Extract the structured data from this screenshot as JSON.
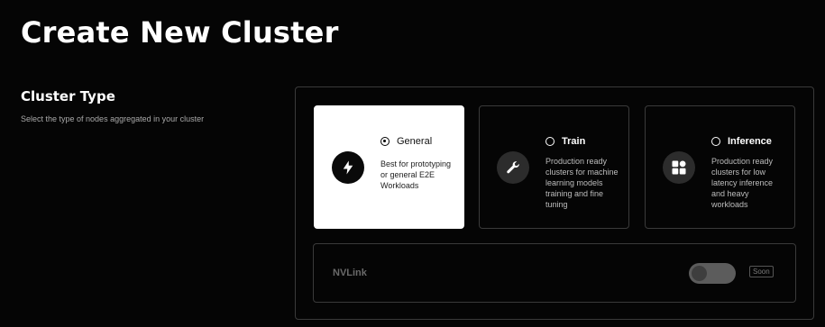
{
  "page": {
    "title": "Create New Cluster"
  },
  "cluster_type": {
    "title": "Cluster Type",
    "description": "Select the type of nodes aggregated in your cluster",
    "options": [
      {
        "label": "General",
        "description": "Best for prototyping or general E2E Workloads",
        "icon": "lightning-bolt-icon",
        "selected": true
      },
      {
        "label": "Train",
        "description": "Production ready clusters for machine learning models training and fine tuning",
        "icon": "wrench-icon",
        "selected": false
      },
      {
        "label": "Inference",
        "description": "Production ready clusters for low latency inference and heavy workloads",
        "icon": "grid-tiles-icon",
        "selected": false
      }
    ]
  },
  "nvlink": {
    "label": "NVLink",
    "badge": "Soon",
    "enabled": false
  },
  "colors": {
    "background": "#050505",
    "selected_card": "#ffffff",
    "border": "#3a3a3a"
  }
}
